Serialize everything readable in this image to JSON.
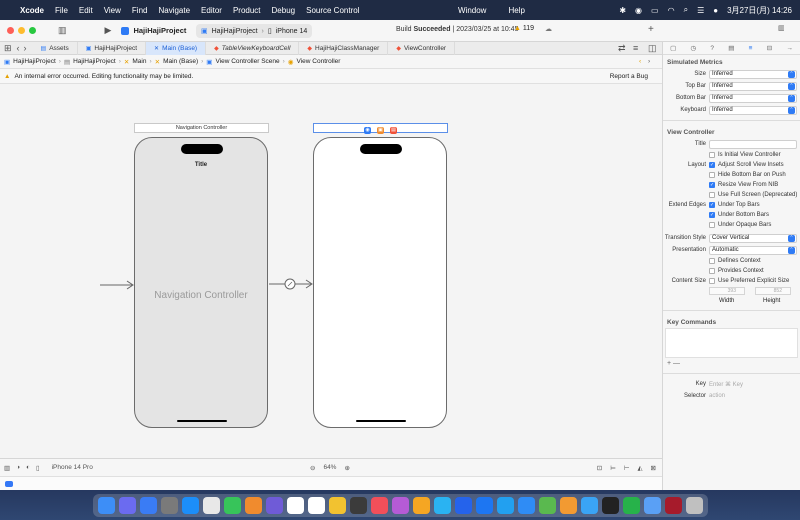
{
  "menubar": {
    "apple": "",
    "app_name": "Xcode",
    "items": [
      "File",
      "Edit",
      "View",
      "Find",
      "Navigate",
      "Editor",
      "Product",
      "Debug",
      "Source Control"
    ],
    "window_items": [
      "Window",
      "Help"
    ],
    "clock": "3月27日(月)  14:26"
  },
  "toolbar": {
    "project_title": "HajiHajiProject",
    "scheme": "HajiHajiProject",
    "destination": "iPhone 14",
    "build_status_prefix": "Build ",
    "build_status_bold": "Succeeded",
    "build_status_suffix": " | 2023/03/25 at 10:45",
    "warnings": "119"
  },
  "tabs": [
    {
      "label": "Assets",
      "active": false
    },
    {
      "label": "HajiHajiProject",
      "active": false
    },
    {
      "label": "Main (Base)",
      "active": true
    },
    {
      "label": "TableViewKeyboardCell",
      "active": false
    },
    {
      "label": "HajiHajiClassManager",
      "active": false
    },
    {
      "label": "ViewController",
      "active": false
    }
  ],
  "jumpbar": [
    "HajiHajiProject",
    "HajiHajiProject",
    "Main",
    "Main (Base)",
    "View Controller Scene",
    "View Controller"
  ],
  "errorbar": {
    "message": "An internal error occurred. Editing functionality may be limited.",
    "report": "Report a Bug"
  },
  "canvas": {
    "nav_scene_title": "Navigation Controller",
    "nav_title": "Title",
    "nav_label": "Navigation Controller"
  },
  "bottombar": {
    "device": "iPhone 14 Pro",
    "zoom": "64%"
  },
  "inspector": {
    "simulated_metrics_title": "Simulated Metrics",
    "metrics": [
      {
        "label": "Size",
        "value": "Inferred"
      },
      {
        "label": "Top Bar",
        "value": "Inferred"
      },
      {
        "label": "Bottom Bar",
        "value": "Inferred"
      },
      {
        "label": "Keyboard",
        "value": "Inferred"
      }
    ],
    "view_controller_title": "View Controller",
    "title_label": "Title",
    "initial_vc": "Is Initial View Controller",
    "layout_label": "Layout",
    "layout_options": [
      {
        "label": "Adjust Scroll View Insets",
        "checked": true
      },
      {
        "label": "Hide Bottom Bar on Push",
        "checked": false
      },
      {
        "label": "Resize View From NIB",
        "checked": true
      },
      {
        "label": "Use Full Screen (Deprecated)",
        "checked": false
      }
    ],
    "extend_edges_label": "Extend Edges",
    "extend_edges": [
      {
        "label": "Under Top Bars",
        "checked": true
      },
      {
        "label": "Under Bottom Bars",
        "checked": true
      },
      {
        "label": "Under Opaque Bars",
        "checked": false
      }
    ],
    "transition_label": "Transition Style",
    "transition_value": "Cover Vertical",
    "presentation_label": "Presentation",
    "presentation_value": "Automatic",
    "defines_context": "Defines Context",
    "provides_context": "Provides Context",
    "content_size_label": "Content Size",
    "preferred_size": "Use Preferred Explicit Size",
    "width_value": "393",
    "height_value": "852",
    "width_label": "Width",
    "height_label": "Height",
    "key_commands_title": "Key Commands",
    "add_remove": "+ —",
    "key_label": "Key",
    "key_placeholder": "Enter ⌘ Key",
    "selector_label": "Selector",
    "selector_placeholder": "action"
  },
  "colors": {
    "accent": "#2f7bf5",
    "menubar_bg": "#1f2b44",
    "tab_active_bg": "#d8e6fb"
  },
  "dock_apps": [
    "#3d8ef7",
    "#6b6bf0",
    "#3a7cf5",
    "#7a7a7a",
    "#1c8ef9",
    "#e8e8e8",
    "#37c45a",
    "#f08b2e",
    "#6f5bd7",
    "#ffffff",
    "#ffffff",
    "#f2c230",
    "#3b3b3b",
    "#f14f5a",
    "#b55bd6",
    "#f5a623",
    "#2ab3f2",
    "#2563eb",
    "#1d76f2",
    "#22a0f0",
    "#2f8cf5",
    "#5ab94f",
    "#f29a32",
    "#3aa4f5",
    "#222222",
    "#27b24a",
    "#5aa0f5",
    "#a61b2b",
    "#c0c0c0"
  ]
}
